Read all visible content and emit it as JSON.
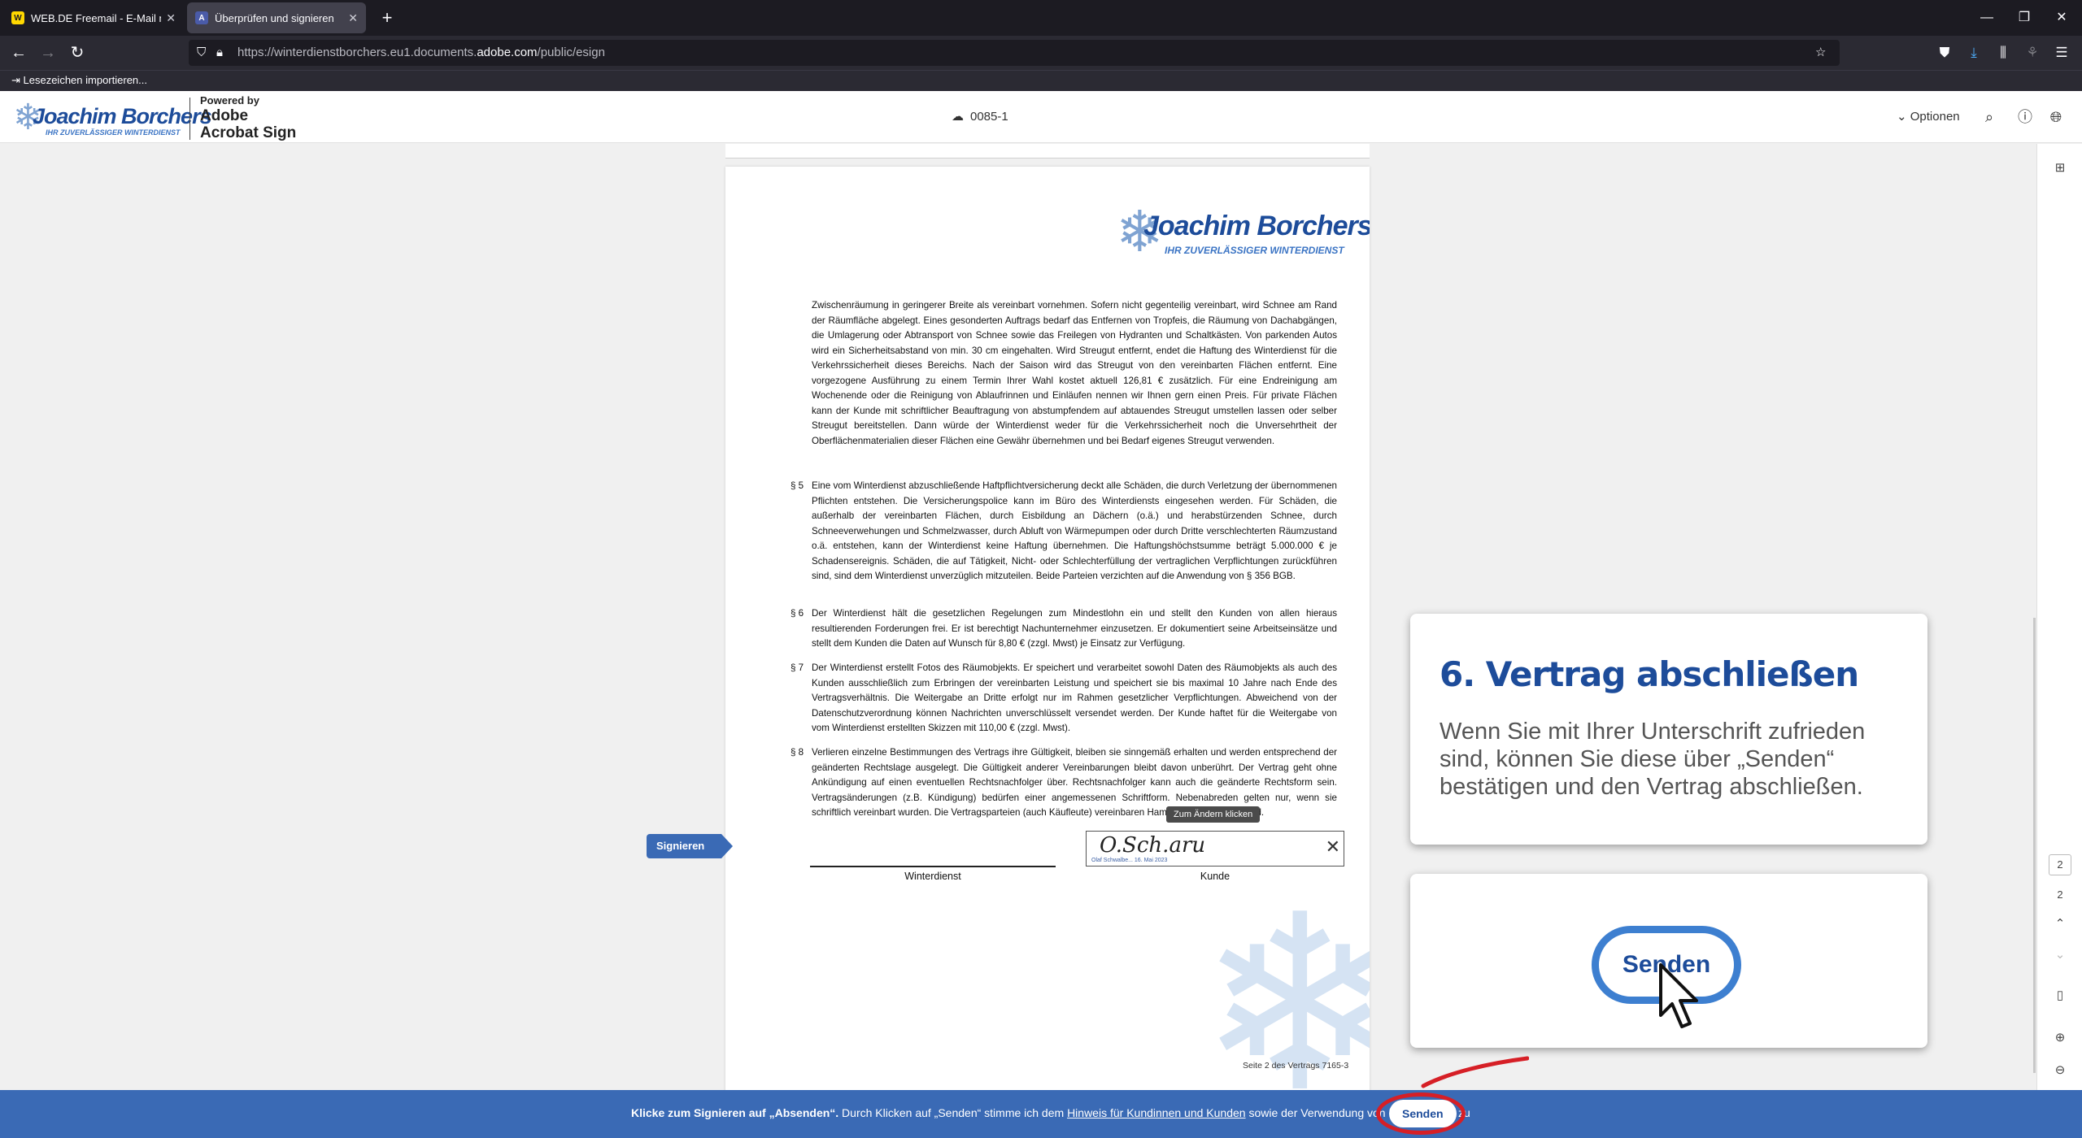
{
  "browser": {
    "tabs": [
      {
        "label": "WEB.DE Freemail - E-Mail mad",
        "favicon": "W",
        "active": false
      },
      {
        "label": "Überprüfen und signieren",
        "favicon": "A",
        "active": true
      }
    ],
    "new_tab": "+",
    "url_prefix": "https://winterdienstborchers.eu1.documents.",
    "url_domain": "adobe.com",
    "url_suffix": "/public/esign",
    "bookmark_import": "Lesezeichen importieren..."
  },
  "header": {
    "brand_name": "Joachim Borchers",
    "brand_tagline": "IHR ZUVERLÄSSIGER WINTERDIENST",
    "powered_by": "Powered by",
    "adobe": "Adobe",
    "acrobat_sign": "Acrobat Sign",
    "document_id": "0085-1",
    "options_label": "Optionen"
  },
  "document": {
    "logo_name": "Joachim Borchers",
    "logo_tagline": "IHR ZUVERLÄSSIGER WINTERDIENST",
    "paragraphs": [
      {
        "num": "",
        "text": "Zwischenräumung in geringerer Breite als vereinbart vornehmen. Sofern nicht gegenteilig vereinbart, wird Schnee am Rand der Räumfläche abgelegt. Eines gesonderten Auftrags bedarf das Entfernen von Tropfeis, die Räumung von Dachabgängen, die Umlagerung oder Abtransport von Schnee sowie das Freilegen von Hydranten und Schaltkästen. Von parkenden Autos wird ein Sicherheitsabstand von min. 30 cm eingehalten. Wird Streugut entfernt, endet die Haftung des Winterdienst für die Verkehrssicherheit dieses Bereichs. Nach der Saison wird das Streugut von den vereinbarten Flächen entfernt. Eine vorgezogene Ausführung zu einem Termin Ihrer Wahl kostet aktuell 126,81 € zusätzlich. Für eine Endreinigung am Wochenende oder die Reinigung von Ablaufrinnen und Einläufen nennen wir Ihnen gern einen Preis. Für private Flächen kann der Kunde mit schriftlicher Beauftragung von abstumpfendem auf abtauendes Streugut umstellen lassen oder selber Streugut bereitstellen. Dann würde der Winterdienst weder für die Verkehrssicherheit noch die Unversehrtheit der Oberflächenmaterialien dieser Flächen eine Gewähr übernehmen und bei Bedarf eigenes Streugut verwenden."
      },
      {
        "num": "§ 5",
        "text": "Eine vom Winterdienst abzuschließende Haftpflichtversicherung deckt alle Schäden, die durch Verletzung der übernommenen Pflichten entstehen. Die Versicherungspolice kann im Büro des Winterdiensts eingesehen werden. Für Schäden, die außerhalb der vereinbarten Flächen, durch Eisbildung an Dächern (o.ä.) und herabstürzenden Schnee, durch Schneeverwehungen und Schmelzwasser, durch Abluft von Wärmepumpen oder durch Dritte verschlechterten Räumzustand o.ä. entstehen, kann der Winterdienst keine Haftung übernehmen. Die Haftungshöchstsumme beträgt 5.000.000 € je Schadensereignis. Schäden, die auf Tätigkeit, Nicht- oder Schlechterfüllung der vertraglichen Verpflichtungen zurückführen sind, sind dem Winterdienst unverzüglich mitzuteilen. Beide Parteien verzichten auf die Anwendung von § 356 BGB."
      },
      {
        "num": "§ 6",
        "text": "Der Winterdienst hält die gesetzlichen Regelungen zum Mindestlohn ein und stellt den Kunden von allen hieraus resultierenden Forderungen frei. Er ist berechtigt Nachunternehmer einzusetzen. Er dokumentiert seine Arbeitseinsätze und stellt dem Kunden die Daten auf Wunsch für 8,80 € (zzgl. Mwst) je Einsatz zur Verfügung."
      },
      {
        "num": "§ 7",
        "text": "Der Winterdienst erstellt Fotos des Räumobjekts. Er speichert und verarbeitet sowohl Daten des Räumobjekts als auch des Kunden ausschließlich zum Erbringen der vereinbarten Leistung und speichert sie bis maximal 10 Jahre nach Ende des Vertragsverhältnis. Die Weitergabe an Dritte erfolgt nur im Rahmen gesetzlicher Verpflichtungen. Abweichend von der Datenschutzverordnung können Nachrichten unverschlüsselt versendet werden. Der Kunde haftet für die Weitergabe von vom Winterdienst erstellten Skizzen mit 110,00 € (zzgl. Mwst)."
      },
      {
        "num": "§ 8",
        "text": "Verlieren einzelne Bestimmungen des Vertrags ihre Gültigkeit, bleiben sie sinngemäß erhalten und werden entsprechend der geänderten Rechtslage ausgelegt. Die Gültigkeit anderer Vereinbarungen bleibt davon unberührt. Der Vertrag geht ohne Ankündigung auf einen eventuellen Rechtsnachfolger über. Rechtsnachfolger kann auch die geänderte Rechtsform sein. Vertragsänderungen (z.B. Kündigung) bedürfen einer angemessenen Schriftform. Nebenabreden gelten nur, wenn sie schriftlich vereinbart wurden. Die Vertragsparteien (auch Käufleute) vereinbaren Hamburg als Gerichtsstand."
      }
    ],
    "tooltip": "Zum Ändern klicken",
    "signature_scribble": "O.Sch.aru",
    "signature_meta": "Olaf Schwalbe... 16. Mai 2023",
    "label_left": "Winterdienst",
    "label_right": "Kunde",
    "page_number": "Seite 2 des Vertrags 7165-3",
    "sign_tag": "Signieren"
  },
  "tutorial": {
    "heading": "6. Vertrag abschließen",
    "body": "Wenn Sie mit Ihrer Unterschrift zufrieden sind, können Sie diese über „Senden“ bestätigen und den Vertrag abschließen.",
    "button": "Senden"
  },
  "rail": {
    "page_current": "2",
    "page_total": "2"
  },
  "bottom": {
    "bold_prefix": "Klicke zum Signieren auf „Absenden“.",
    "text_mid": " Durch Klicken auf „Senden“ stimme ich dem ",
    "link": "Hinweis für Kundinnen und Kunden",
    "text_end": " sowie der Verwendung von E-Signaturen zu",
    "send_button": "Senden"
  },
  "colors": {
    "brand_blue": "#1d4c9a",
    "bar_blue": "#3a6ab5",
    "highlight_red": "#d61f26"
  }
}
